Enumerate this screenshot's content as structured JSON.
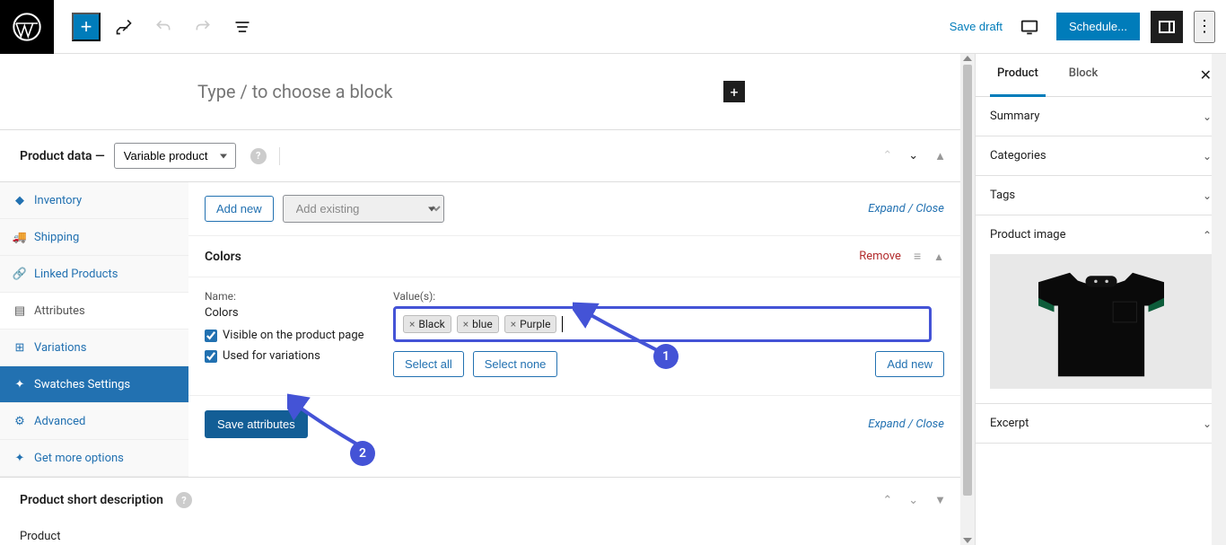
{
  "toolbar": {
    "save_draft": "Save draft",
    "schedule": "Schedule..."
  },
  "block_prompt": "Type / to choose a block",
  "product_data": {
    "label": "Product data —",
    "type_selected": "Variable product",
    "tabs": [
      {
        "id": "inventory",
        "label": "Inventory"
      },
      {
        "id": "shipping",
        "label": "Shipping"
      },
      {
        "id": "linked",
        "label": "Linked Products"
      },
      {
        "id": "attributes",
        "label": "Attributes"
      },
      {
        "id": "variations",
        "label": "Variations"
      },
      {
        "id": "swatches",
        "label": "Swatches Settings"
      },
      {
        "id": "advanced",
        "label": "Advanced"
      },
      {
        "id": "more",
        "label": "Get more options"
      }
    ],
    "add_new": "Add new",
    "add_existing_placeholder": "Add existing",
    "expand_close": "Expand / Close",
    "attribute": {
      "title": "Colors",
      "remove": "Remove",
      "name_label": "Name:",
      "name_value": "Colors",
      "values_label": "Value(s):",
      "visible_label": "Visible on the product page",
      "used_variations_label": "Used for variations",
      "values": [
        "Black",
        "blue",
        "Purple"
      ],
      "select_all": "Select all",
      "select_none": "Select none",
      "add_new_value": "Add new"
    },
    "save_attributes": "Save attributes",
    "expand_close_bottom": "Expand / Close"
  },
  "short_desc": {
    "title": "Product short description"
  },
  "footer_text": "Product",
  "sidebar": {
    "tabs": [
      "Product",
      "Block"
    ],
    "sections": {
      "summary": "Summary",
      "categories": "Categories",
      "tags": "Tags",
      "product_image": "Product image",
      "excerpt": "Excerpt"
    }
  },
  "annotations": {
    "badge1": "1",
    "badge2": "2"
  },
  "colors": {
    "accent": "#007cba",
    "annotation": "#4453d6",
    "link": "#2271b1",
    "danger": "#b32d2e"
  }
}
